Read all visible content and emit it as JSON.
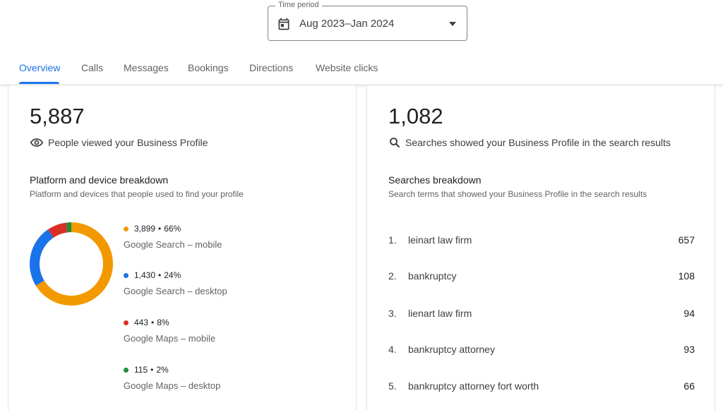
{
  "period": {
    "legend": "Time period",
    "value": "Aug 2023–Jan 2024"
  },
  "tabs": [
    {
      "label": "Overview",
      "active": true
    },
    {
      "label": "Calls"
    },
    {
      "label": "Messages"
    },
    {
      "label": "Bookings"
    },
    {
      "label": "Directions"
    },
    {
      "label": "Website clicks"
    }
  ],
  "views": {
    "total": "5,887",
    "label": "People viewed your Business Profile",
    "breakdown_title": "Platform and device breakdown",
    "breakdown_subtitle": "Platform and devices that people used to find your profile",
    "items": [
      {
        "value": "3,899",
        "percent": "66%",
        "label": "Google Search – mobile",
        "color": "#f29900"
      },
      {
        "value": "1,430",
        "percent": "24%",
        "label": "Google Search – desktop",
        "color": "#1a73e8"
      },
      {
        "value": "443",
        "percent": "8%",
        "label": "Google Maps – mobile",
        "color": "#d93025"
      },
      {
        "value": "115",
        "percent": "2%",
        "label": "Google Maps – desktop",
        "color": "#1e8e3e"
      }
    ]
  },
  "chart_data": {
    "type": "pie",
    "categories": [
      "Google Search – mobile",
      "Google Search – desktop",
      "Google Maps – mobile",
      "Google Maps – desktop"
    ],
    "values": [
      3899,
      1430,
      443,
      115
    ],
    "colors": [
      "#f29900",
      "#1a73e8",
      "#d93025",
      "#1e8e3e"
    ]
  },
  "searches": {
    "total": "1,082",
    "label": "Searches showed your Business Profile in the search results",
    "breakdown_title": "Searches breakdown",
    "breakdown_subtitle": "Search terms that showed your Business Profile in the search results",
    "items": [
      {
        "rank": "1.",
        "term": "leinart law firm",
        "count": "657"
      },
      {
        "rank": "2.",
        "term": "bankruptcy",
        "count": "108"
      },
      {
        "rank": "3.",
        "term": "lienart law firm",
        "count": "94"
      },
      {
        "rank": "4.",
        "term": "bankruptcy attorney",
        "count": "93"
      },
      {
        "rank": "5.",
        "term": "bankruptcy attorney fort worth",
        "count": "66"
      }
    ]
  }
}
